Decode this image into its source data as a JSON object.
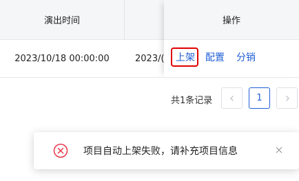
{
  "table": {
    "headers": [
      "演出时间",
      "",
      "操作"
    ],
    "row": {
      "show_time": "2023/10/18 00:00:00",
      "truncated_time": "2023/("
    },
    "actions": [
      "上架",
      "配置",
      "分销"
    ]
  },
  "pagination": {
    "total": "共1条记录",
    "current_page": "1",
    "prev_icon": "chevron-left-icon",
    "next_icon": "chevron-right-icon"
  },
  "toast": {
    "message": "项目自动上架失败，请补充项目信息",
    "icon": "error-circle-icon",
    "close_icon": "close-icon",
    "error_color": "#e6354a"
  },
  "colors": {
    "link": "#1f5fd6",
    "highlight": "#e00000",
    "header_bg": "#f5f6f8"
  }
}
